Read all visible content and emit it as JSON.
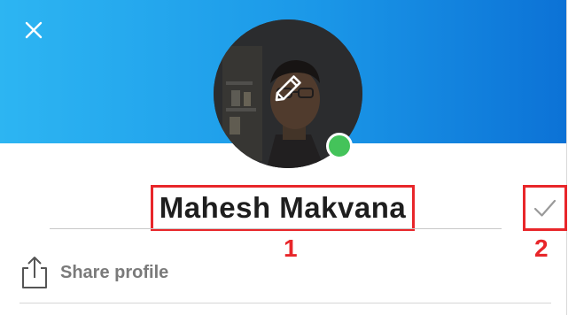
{
  "profile": {
    "display_name": "Mahesh Makvana"
  },
  "annotations": {
    "callout_name": "1",
    "callout_confirm": "2"
  },
  "actions": {
    "share_label": "Share profile"
  },
  "icons": {
    "close": "close-icon",
    "edit": "pencil-icon",
    "confirm": "checkmark-icon",
    "share": "share-icon"
  },
  "status": {
    "presence": "online",
    "presence_color": "#44c35a"
  },
  "colors": {
    "banner_start": "#2db5f2",
    "banner_end": "#0c72d6",
    "annotation_red": "#e8262a"
  }
}
